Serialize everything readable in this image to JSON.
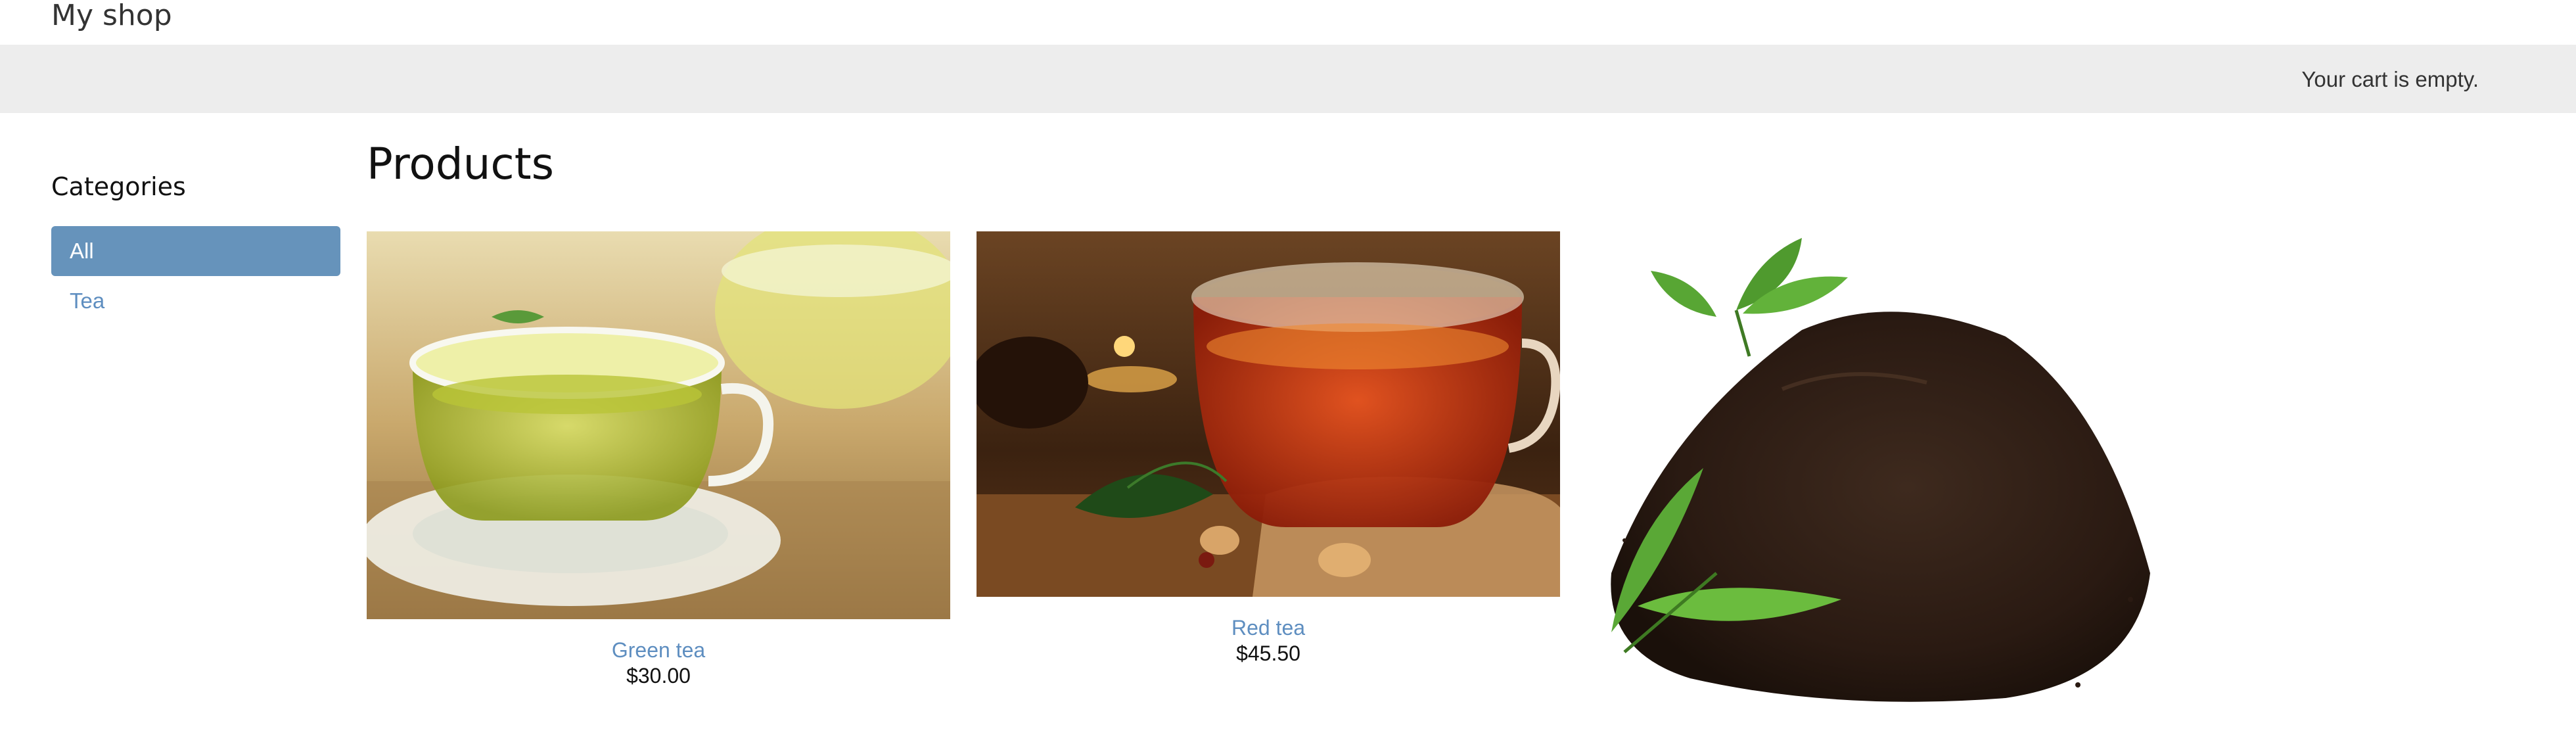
{
  "header": {
    "brand": "My shop"
  },
  "cart": {
    "status": "Your cart is empty."
  },
  "sidebar": {
    "title": "Categories",
    "items": [
      {
        "label": "All",
        "selected": true
      },
      {
        "label": "Tea",
        "selected": false
      }
    ]
  },
  "main": {
    "title": "Products",
    "products": [
      {
        "name": "Green tea",
        "price": "$30.00",
        "image_icon": "green-tea-cup-photo"
      },
      {
        "name": "Red tea",
        "price": "$45.50",
        "image_icon": "red-tea-cup-photo"
      },
      {
        "name": "",
        "price": "",
        "image_icon": "loose-tea-leaves-photo"
      }
    ]
  },
  "colors": {
    "link": "#5e8ec0",
    "selected_bg": "#6693bb",
    "cartbar_bg": "#ededed"
  }
}
